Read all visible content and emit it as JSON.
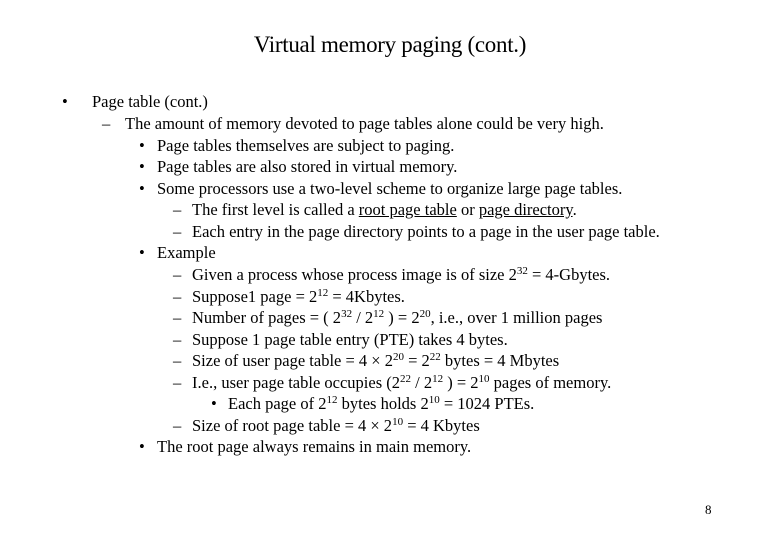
{
  "slide": {
    "title": "Virtual memory paging (cont.)",
    "page_number": "8",
    "bullet_glyph": "•",
    "dash_glyph": "–",
    "items": {
      "l1": "Page table (cont.)",
      "l2": "The amount of memory devoted to page tables alone could be very high.",
      "l3": "Page tables themselves are subject to paging.",
      "l4": "Page tables are also stored in virtual memory.",
      "l5": "Some processors use a two-level scheme to organize large page tables.",
      "l6": {
        "pre": "The first level is called a ",
        "term1": "root page table",
        "mid": " or ",
        "term2": "page directory",
        "post": "."
      },
      "l7": "Each entry in the page directory points to a page in the user page table.",
      "l8": "Example",
      "l9": {
        "a": "Given a process whose process image is of size 2",
        "e1": "32",
        "b": " = 4-Gbytes."
      },
      "l10": {
        "a": "Suppose1 page = 2",
        "e1": "12",
        "b": " = 4Kbytes."
      },
      "l11": {
        "a": "Number of pages = ( 2",
        "e1": "32",
        "b": " / 2",
        "e2": "12",
        "c": " ) = 2",
        "e3": "20",
        "d": ", i.e., over 1 million pages"
      },
      "l12": "Suppose 1 page table entry (PTE) takes 4 bytes.",
      "l13": {
        "a": "Size of user page table = 4 × 2",
        "e1": "20",
        "b": "  = 2",
        "e2": "22",
        "c": " bytes = 4 Mbytes"
      },
      "l14": {
        "a": "I.e., user page table occupies (2",
        "e1": "22",
        "b": " / 2",
        "e2": "12",
        "c": " ) = 2",
        "e3": "10",
        "d": " pages of memory."
      },
      "l15": {
        "a": "Each page of 2",
        "e1": "12",
        "b": " bytes holds 2",
        "e2": "10",
        "c": " = 1024 PTEs."
      },
      "l16": {
        "a": "Size of root page table = 4 × 2",
        "e1": "10",
        "b": " = 4 Kbytes"
      },
      "l17": "The root page always remains in main memory."
    }
  }
}
